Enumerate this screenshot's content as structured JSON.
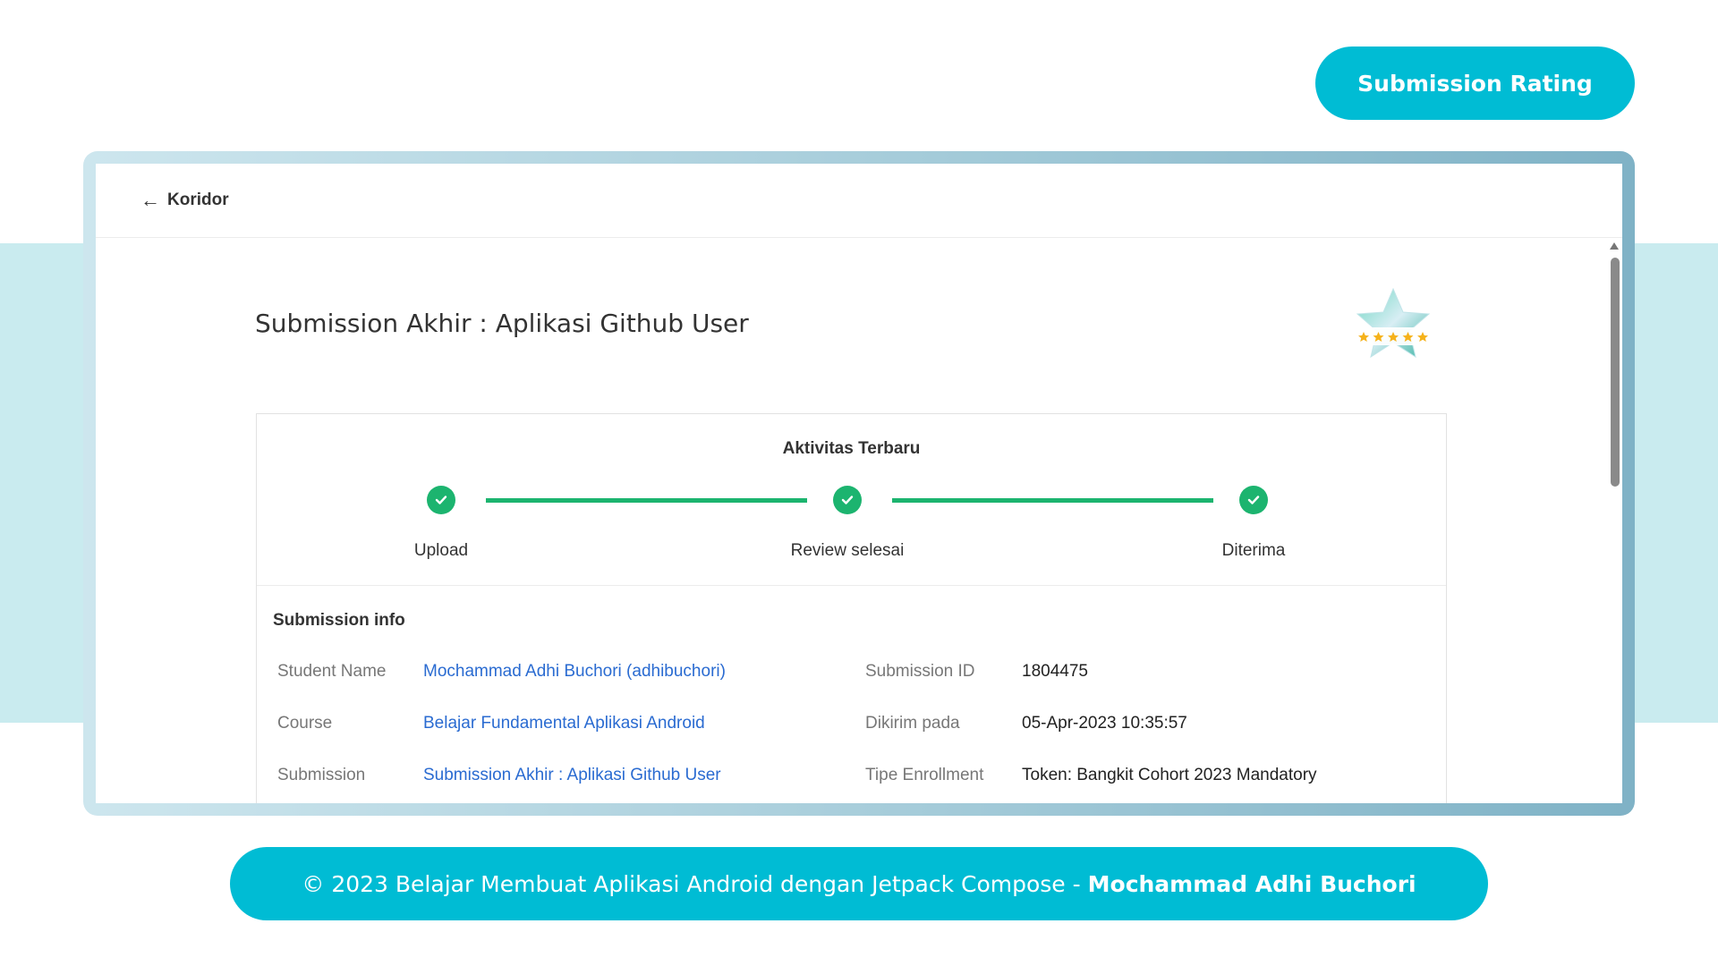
{
  "header": {
    "rating_button": "Submission Rating"
  },
  "topbar": {
    "back_arrow": "←",
    "back_label": "Koridor"
  },
  "page": {
    "title": "Submission Akhir : Aplikasi Github User",
    "badge_icon": "star-rating-badge-icon"
  },
  "activity": {
    "title": "Aktivitas Terbaru",
    "steps": [
      {
        "label": "Upload",
        "status": "done"
      },
      {
        "label": "Review selesai",
        "status": "done"
      },
      {
        "label": "Diterima",
        "status": "done"
      }
    ]
  },
  "submission_info": {
    "title": "Submission info",
    "left": [
      {
        "key": "Student Name",
        "value": "Mochammad Adhi Buchori (adhibuchori)"
      },
      {
        "key": "Course",
        "value": "Belajar Fundamental Aplikasi Android"
      },
      {
        "key": "Submission",
        "value": "Submission Akhir : Aplikasi Github User"
      }
    ],
    "right": [
      {
        "key": "Submission ID",
        "value": "1804475"
      },
      {
        "key": "Dikirim pada",
        "value": "05-Apr-2023 10:35:57"
      },
      {
        "key": "Tipe Enrollment",
        "value": "Token: Bangkit Cohort 2023 Mandatory"
      }
    ]
  },
  "footer": {
    "text": "© 2023 Belajar Membuat Aplikasi Android dengan Jetpack Compose -",
    "author": "Mochammad Adhi Buchori"
  },
  "colors": {
    "accent": "#00bcd4",
    "success": "#1cb46f",
    "link": "#2a6bd1",
    "band": "#c9ebef"
  }
}
